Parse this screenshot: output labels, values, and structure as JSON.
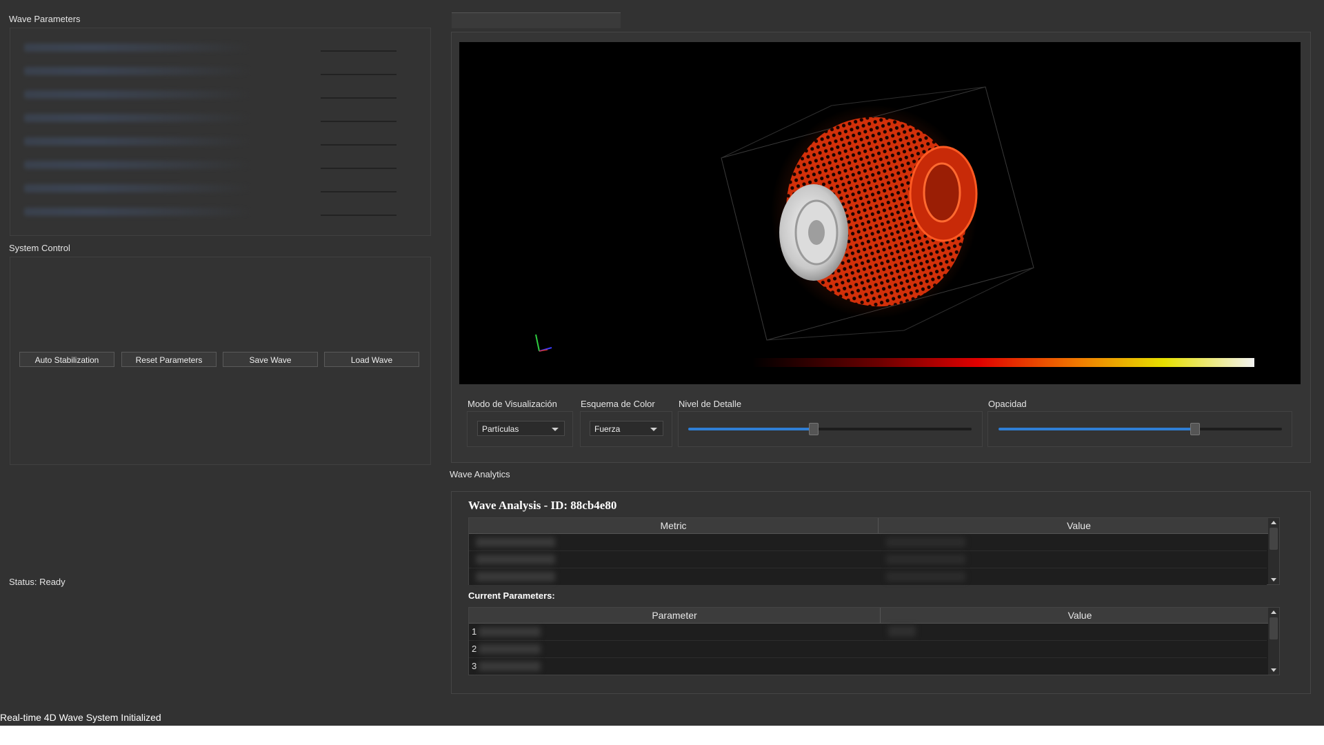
{
  "left_panel": {
    "wave_params_title": "Wave Parameters",
    "system_control_title": "System Control",
    "buttons": [
      "Auto Stabilization",
      "Reset Parameters",
      "Save Wave",
      "Load Wave"
    ],
    "status": "Status: Ready"
  },
  "controls": {
    "mode_label": "Modo de Visualización",
    "mode_value": "Partículas",
    "color_label": "Esquema de Color",
    "color_value": "Fuerza",
    "detail_label": "Nivel de Detalle",
    "detail_level": 0.44,
    "opacity_label": "Opacidad",
    "opacity_level": 0.69
  },
  "analytics": {
    "group_title": "Wave Analytics",
    "title": "Wave Analysis - ID: 88cb4e80",
    "metrics_headers": [
      "Metric",
      "Value"
    ],
    "params_heading": "Current Parameters:",
    "params_headers": [
      "Parameter",
      "Value"
    ],
    "param_row_numbers": [
      "1",
      "2",
      "3"
    ]
  },
  "bottom_status": "Real-time 4D Wave System Initialized",
  "colors": {
    "background": "#323232",
    "viewport": "#000000",
    "accent": "#2f7fd6",
    "particles": "#d2300a"
  }
}
